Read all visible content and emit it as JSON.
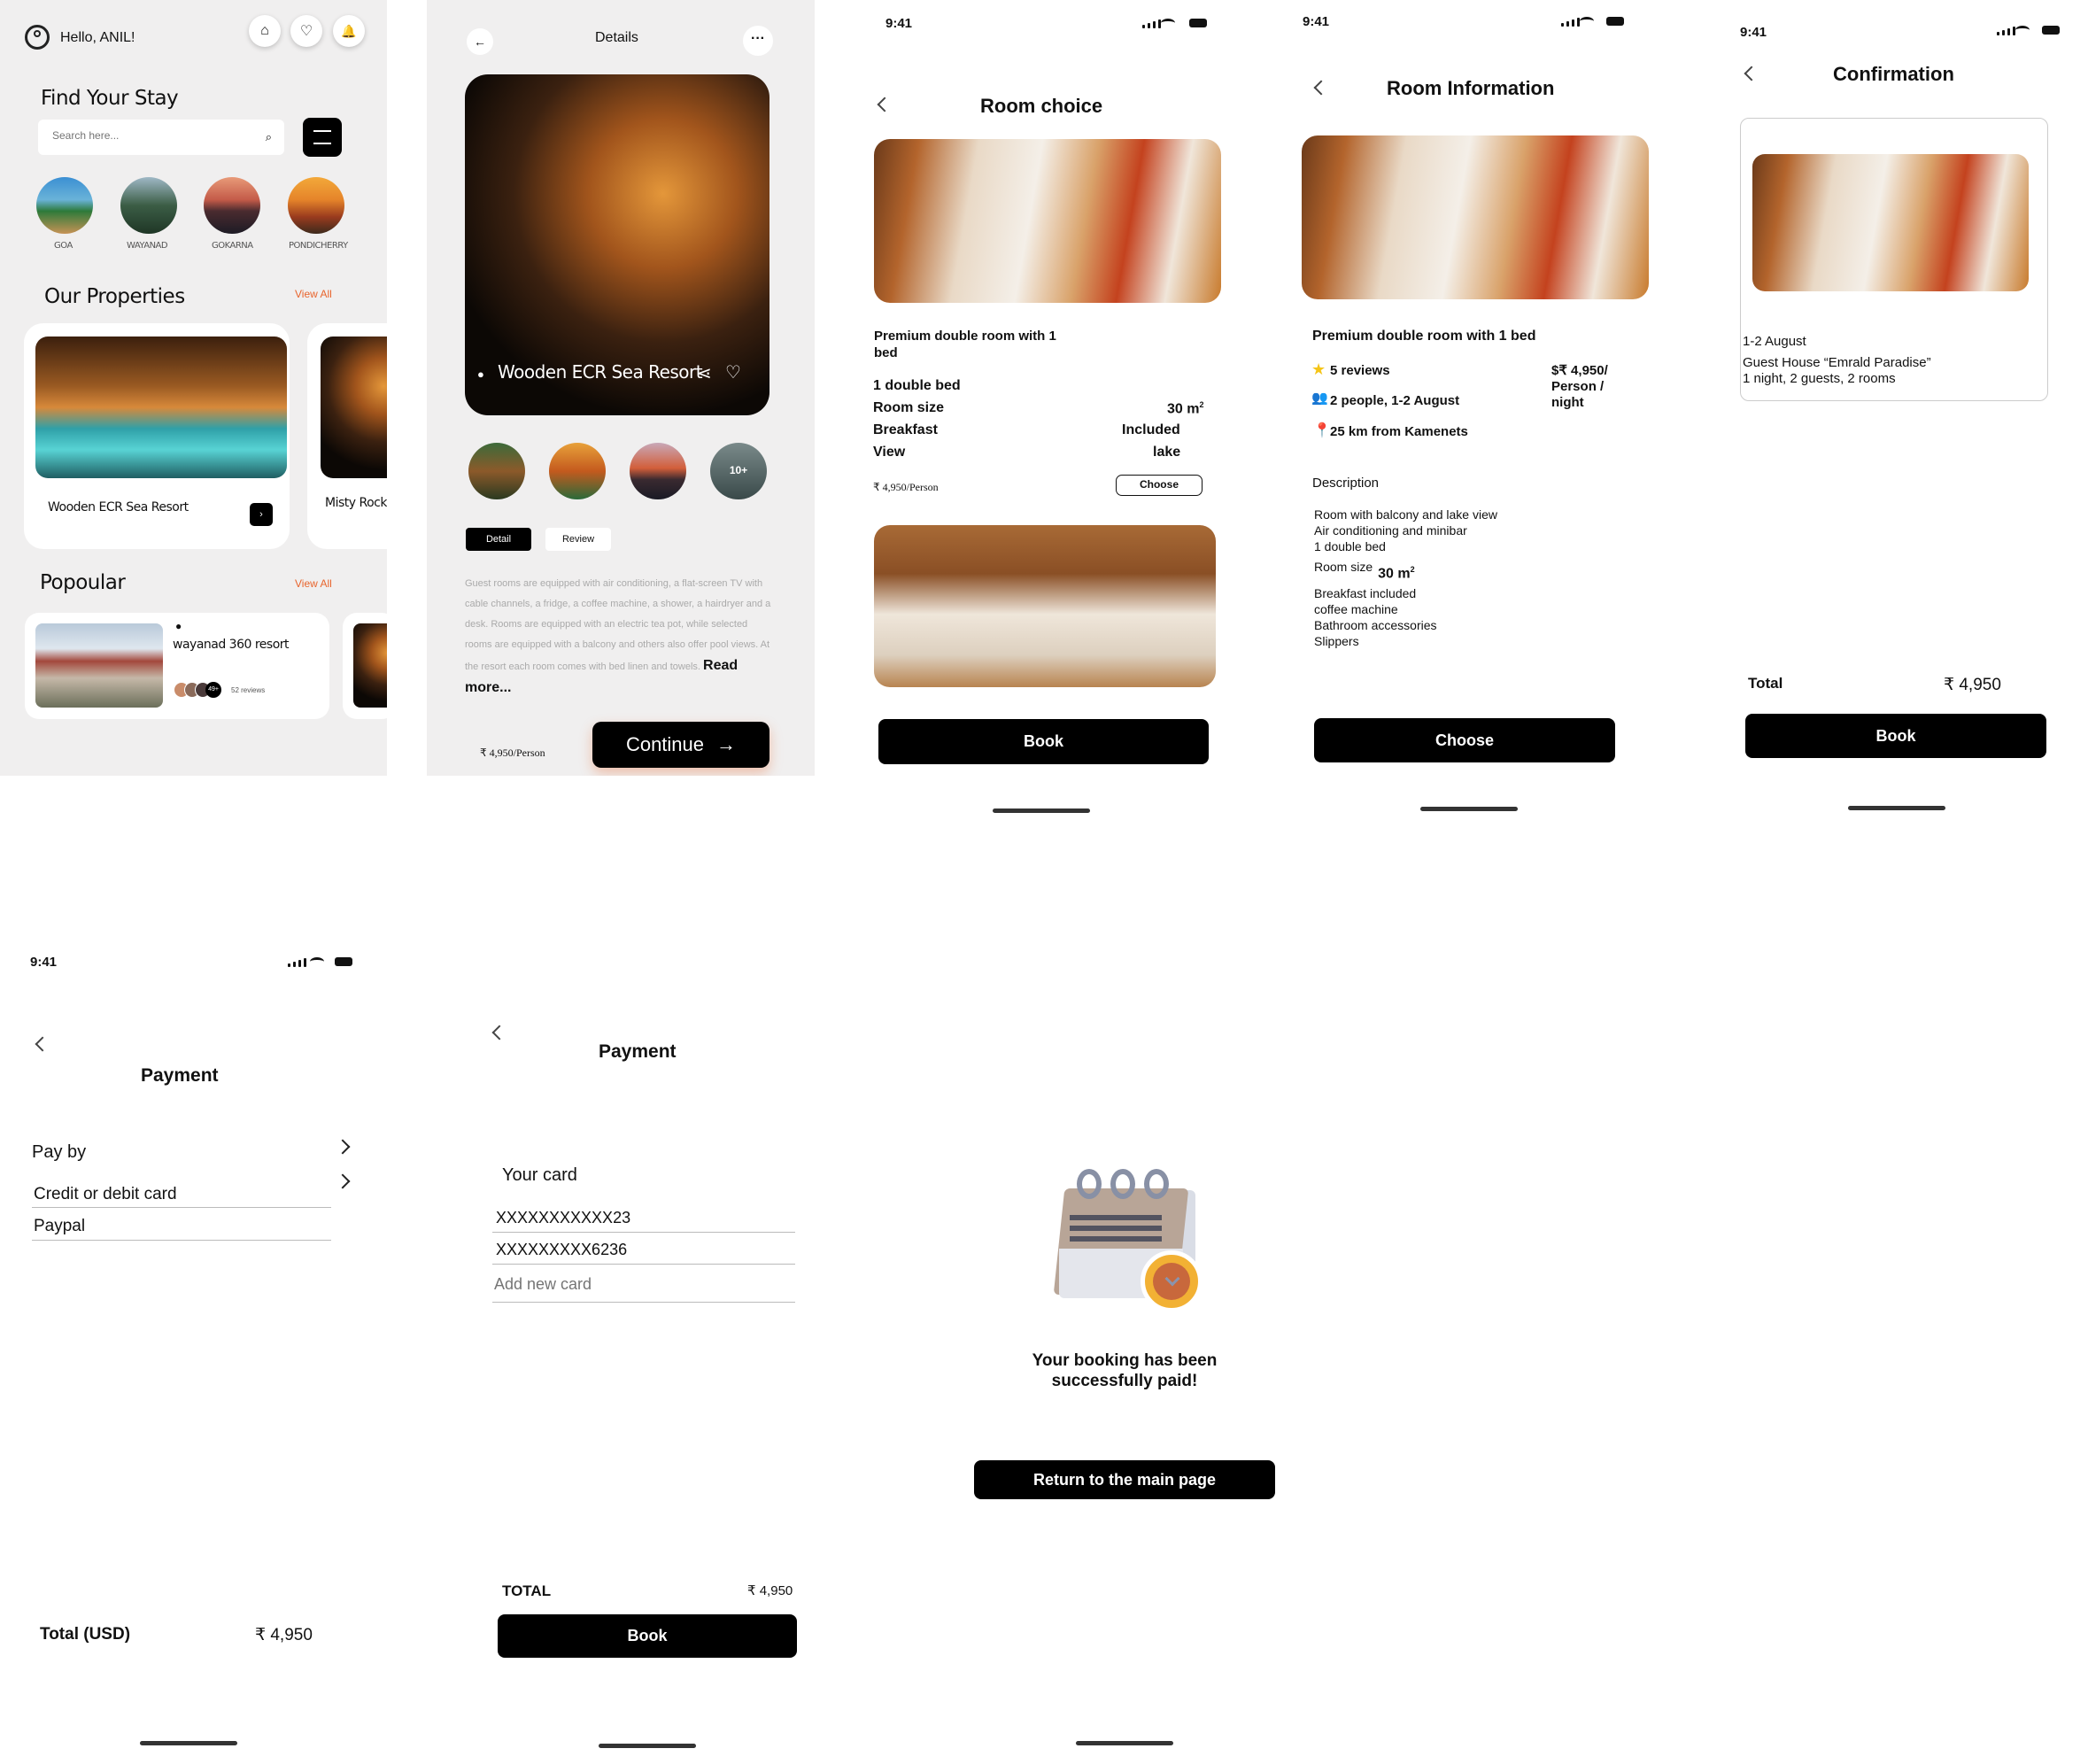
{
  "home": {
    "greeting": "Hello, ANIL!",
    "heading": "Find Your Stay",
    "search_placeholder": "Search here...",
    "destinations": [
      "GOA",
      "WAYANAD",
      "GOKARNA",
      "PONDICHERRY"
    ],
    "properties_heading": "Our Properties",
    "view_all": "View All",
    "property1": "Wooden ECR Sea Resort",
    "property2": "Misty Rock F",
    "popular_heading": "Popoular",
    "popular_view_all": "View All",
    "popular_name": "wayanad 360 resort",
    "popular_avatar_count": "49+",
    "popular_reviews": "52 reviews"
  },
  "details": {
    "title": "Details",
    "resort_name": "Wooden ECR Sea Resort",
    "more_thumbs": "10+",
    "tab_detail": "Detail",
    "tab_review": "Review",
    "description": "Guest rooms are equipped with air conditioning, a flat-screen TV with cable channels, a fridge, a coffee machine, a shower, a hairdryer and a desk. Rooms are equipped with an electric tea pot, while selected rooms are equipped with a balcony and others also offer pool views. At the resort each room comes with bed linen and towels.",
    "read_more": "Read more...",
    "price": "₹ 4,950/Person",
    "continue": "Continue"
  },
  "room_choice": {
    "time": "9:41",
    "title": "Room choice",
    "room_name": "Premium double room with 1 bed",
    "bed": "1 double bed",
    "room_size_label": "Room size",
    "room_size_value": "30 m",
    "room_size_sup": "2",
    "breakfast_label": "Breakfast",
    "breakfast_value": "Included",
    "view_label": "View",
    "view_value": "lake",
    "price": "₹ 4,950/Person",
    "choose": "Choose",
    "book": "Book"
  },
  "room_info": {
    "time": "9:41",
    "title": "Room Information",
    "room_name": "Premium double room with 1 bed",
    "reviews": "5 reviews",
    "people": "2 people, 1-2 August",
    "distance": "25 km from Kamenets",
    "price_line1": "$₹ 4,950/",
    "price_line2": "Person /",
    "price_line3": "night",
    "description_label": "Description",
    "features1": [
      "Room with balcony and lake view",
      "Air conditioning and minibar",
      "1 double bed"
    ],
    "room_size_label": "Room size",
    "room_size_value": "30 m",
    "room_size_sup": "2",
    "features2": [
      "Breakfast included",
      "coffee machine",
      "Bathroom accessories",
      "Slippers"
    ],
    "choose": "Choose"
  },
  "confirmation": {
    "time": "9:41",
    "title": "Confirmation",
    "dates": "1-2 August",
    "guest_house": "Guest House “Emrald Paradise”",
    "summary": "1 night, 2 guests, 2 rooms",
    "total_label": "Total",
    "total_value": "₹ 4,950",
    "book": "Book"
  },
  "payment1": {
    "time": "9:41",
    "title": "Payment",
    "pay_by": "Pay by",
    "option1": "Credit or debit card",
    "option2": "Paypal",
    "total_label": "Total (USD)",
    "total_value": "₹ 4,950"
  },
  "payment2": {
    "title": "Payment",
    "your_card": "Your card",
    "card1": "XXXXXXXXXXX23",
    "card2": "XXXXXXXXX6236",
    "add_card_placeholder": "Add new card",
    "total_label": "TOTAL",
    "total_value": "₹ 4,950",
    "book": "Book"
  },
  "success": {
    "message_line1": "Your booking has been",
    "message_line2": "successfully paid!",
    "return_button": "Return to the main page"
  },
  "colors": {
    "accent": "#e8642c",
    "primary": "#000000",
    "screen_bg": "#f0efef"
  }
}
